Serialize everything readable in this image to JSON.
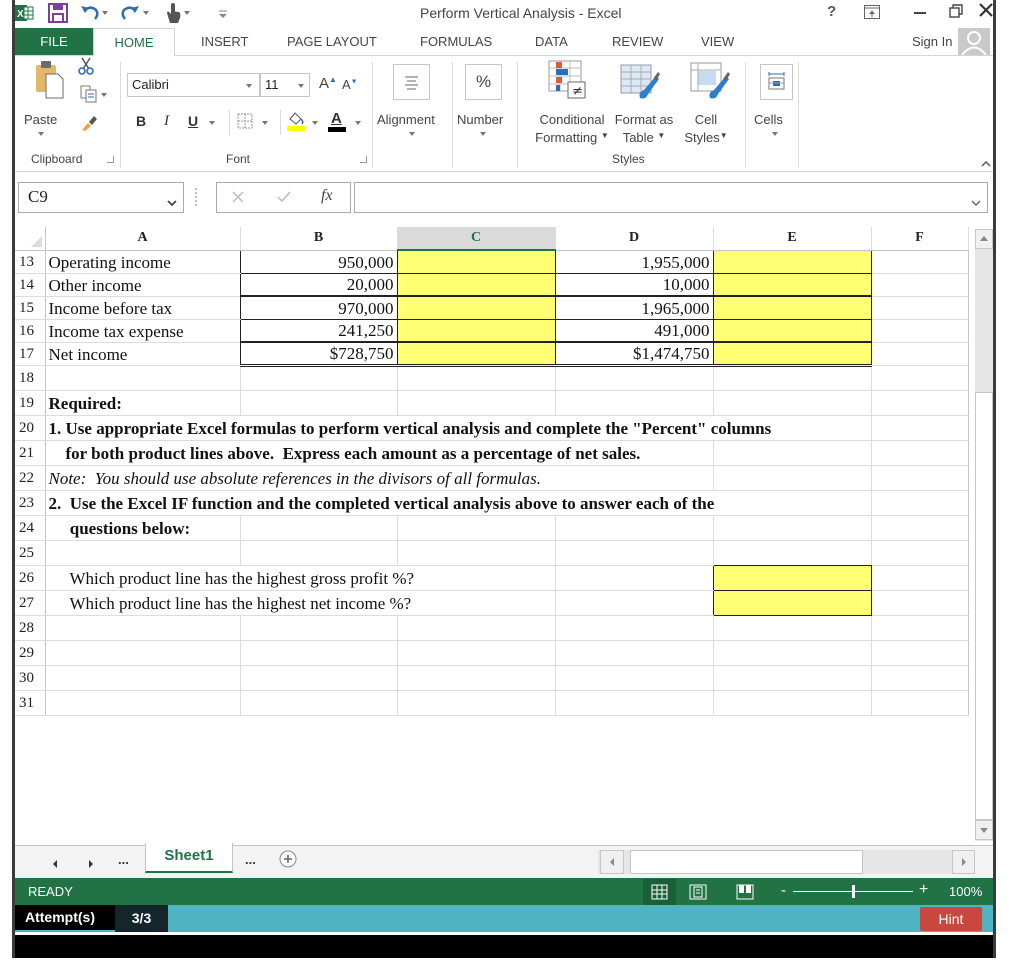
{
  "window": {
    "title": "Perform Vertical Analysis - Excel",
    "help": "?"
  },
  "tabs": [
    {
      "label": "FILE"
    },
    {
      "label": "HOME",
      "active": true
    },
    {
      "label": "INSERT"
    },
    {
      "label": "PAGE LAYOUT"
    },
    {
      "label": "FORMULAS"
    },
    {
      "label": "DATA"
    },
    {
      "label": "REVIEW"
    },
    {
      "label": "VIEW"
    }
  ],
  "account": {
    "sign_in": "Sign In"
  },
  "ribbon": {
    "clipboard": {
      "paste": "Paste",
      "group_label": "Clipboard"
    },
    "font": {
      "name": "Calibri",
      "size": "11",
      "grow": "A",
      "shrink": "A",
      "bold": "B",
      "italic": "I",
      "underline": "U",
      "font_color_letter": "A",
      "group_label": "Font"
    },
    "alignment": {
      "label": "Alignment"
    },
    "number": {
      "label": "Number",
      "symbol": "%"
    },
    "styles": {
      "conditional_formatting": [
        "Conditional",
        "Formatting"
      ],
      "format_as_table": [
        "Format as",
        "Table"
      ],
      "cell_styles": [
        "Cell",
        "Styles"
      ],
      "group_label": "Styles"
    },
    "cells": {
      "label": "Cells"
    }
  },
  "formula_bar": {
    "name_box": "C9",
    "fx": "fx",
    "formula": ""
  },
  "grid": {
    "columns": [
      "A",
      "B",
      "C",
      "D",
      "E",
      "F"
    ],
    "selected_column": "C",
    "rows": [
      {
        "n": "13",
        "table": true,
        "inputs": [
          2,
          4
        ],
        "cells": [
          "Operating income",
          "950,000",
          "",
          "1,955,000",
          "",
          ""
        ]
      },
      {
        "n": "14",
        "table": true,
        "inputs": [
          2,
          4
        ],
        "cells": [
          "Other income",
          "20,000",
          "",
          "10,000",
          "",
          ""
        ]
      },
      {
        "n": "15",
        "table": true,
        "rule": true,
        "inputs": [
          2,
          4
        ],
        "cells": [
          "Income before tax",
          "970,000",
          "",
          "1,965,000",
          "",
          ""
        ]
      },
      {
        "n": "16",
        "table": true,
        "inputs": [
          2,
          4
        ],
        "cells": [
          "Income tax expense",
          "241,250",
          "",
          "491,000",
          "",
          ""
        ]
      },
      {
        "n": "17",
        "table": true,
        "rule": true,
        "total": true,
        "inputs": [
          2,
          4
        ],
        "cells": [
          "Net income",
          "$728,750",
          "",
          "$1,474,750",
          "",
          ""
        ]
      },
      {
        "n": "18",
        "cells": [
          "",
          "",
          "",
          "",
          "",
          ""
        ]
      },
      {
        "n": "19",
        "style": "bold",
        "cells": [
          "Required:",
          "",
          "",
          "",
          "",
          ""
        ]
      },
      {
        "n": "20",
        "style": "bold",
        "span": 5,
        "cells": [
          "1. Use appropriate Excel formulas to perform vertical analysis and complete the \"Percent\" columns",
          "",
          "",
          "",
          "",
          ""
        ]
      },
      {
        "n": "21",
        "style": "bold",
        "span": 4,
        "cells": [
          "    for both product lines above.  Express each amount as a percentage of net sales.",
          "",
          "",
          "",
          "",
          ""
        ]
      },
      {
        "n": "22",
        "style": "italic",
        "span": 4,
        "cells": [
          "Note:  You should use absolute references in the divisors of all formulas.",
          "",
          "",
          "",
          "",
          ""
        ]
      },
      {
        "n": "23",
        "style": "bold",
        "span": 5,
        "cells": [
          "2.  Use the Excel IF function and the completed vertical analysis above to answer each of the",
          "",
          "",
          "",
          "",
          ""
        ]
      },
      {
        "n": "24",
        "style": "bold",
        "cells": [
          "     questions below:",
          "",
          "",
          "",
          "",
          ""
        ]
      },
      {
        "n": "25",
        "cells": [
          "",
          "",
          "",
          "",
          "",
          ""
        ]
      },
      {
        "n": "26",
        "span": 3,
        "inputs": [
          4
        ],
        "cells": [
          "     Which product line has the highest gross profit %?",
          "",
          "",
          "",
          "",
          ""
        ]
      },
      {
        "n": "27",
        "span": 3,
        "inputs": [
          4
        ],
        "cells": [
          "     Which product line has the highest net income %?",
          "",
          "",
          "",
          "",
          ""
        ]
      },
      {
        "n": "28",
        "cells": [
          "",
          "",
          "",
          "",
          "",
          ""
        ]
      },
      {
        "n": "29",
        "cells": [
          "",
          "",
          "",
          "",
          "",
          ""
        ]
      },
      {
        "n": "30",
        "cells": [
          "",
          "",
          "",
          "",
          "",
          ""
        ]
      },
      {
        "n": "31",
        "cells": [
          "",
          "",
          "",
          "",
          "",
          ""
        ]
      }
    ]
  },
  "sheets": {
    "overflow_left": "...",
    "active": "Sheet1",
    "overflow_right": "..."
  },
  "status": {
    "mode": "READY",
    "zoom_label": "100%",
    "zoom_percent": 100,
    "zoom_minus": "-",
    "zoom_plus": "+"
  },
  "attempts": {
    "label": "Attempt(s)",
    "value": "3/3",
    "hint": "Hint"
  },
  "colors": {
    "excel_green": "#217346",
    "input_yellow": "#FFFF73",
    "attempt_bar_teal": "#4FB3C2",
    "hint_red": "#C9473F"
  }
}
